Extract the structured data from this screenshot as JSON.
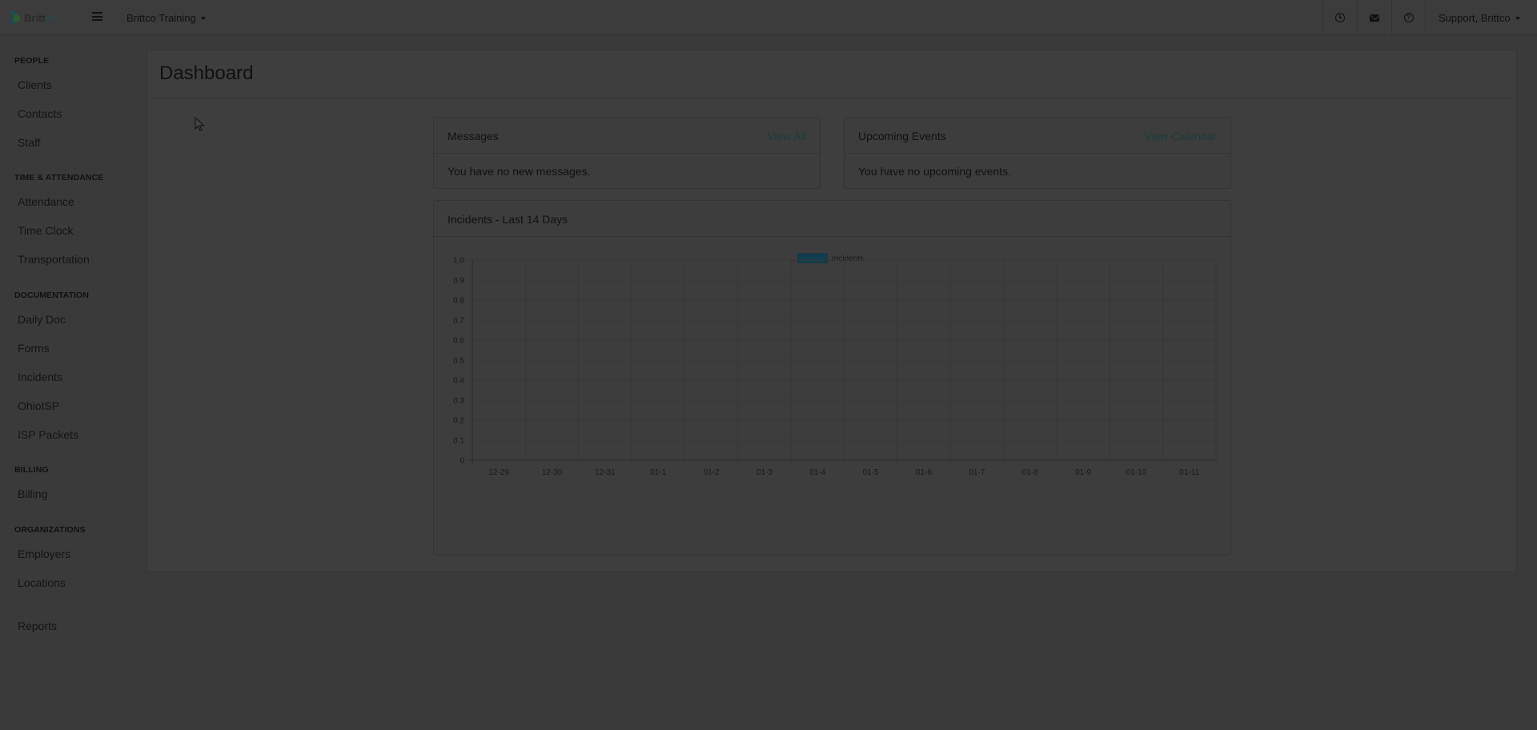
{
  "app": {
    "logo_text": "Britt",
    "logo_text_accent": "co",
    "org_selector": "Brittco Training",
    "user_menu": "Support, Brittco"
  },
  "top_icons": [
    "clock-icon",
    "mail-icon",
    "help-icon"
  ],
  "sidebar": {
    "sections": [
      {
        "heading": "PEOPLE",
        "items": [
          "Clients",
          "Contacts",
          "Staff"
        ]
      },
      {
        "heading": "TIME & ATTENDANCE",
        "items": [
          "Attendance",
          "Time Clock",
          "Transportation"
        ]
      },
      {
        "heading": "DOCUMENTATION",
        "items": [
          "Daily Doc",
          "Forms",
          "Incidents",
          "OhioISP",
          "ISP Packets"
        ]
      },
      {
        "heading": "BILLING",
        "items": [
          "Billing"
        ]
      },
      {
        "heading": "ORGANIZATIONS",
        "items": [
          "Employers",
          "Locations"
        ]
      }
    ],
    "extra_item": "Reports"
  },
  "main": {
    "title": "Dashboard",
    "messages": {
      "title": "Messages",
      "link": "View All",
      "body": "You have no new messages."
    },
    "events": {
      "title": "Upcoming Events",
      "link": "View Calendar",
      "body": "You have no upcoming events."
    },
    "incidents": {
      "title": "Incidents - Last 14 Days"
    }
  },
  "colors": {
    "series": "#123f50",
    "link": "#1b3c3a"
  },
  "chart_data": {
    "type": "bar",
    "categories": [
      "12-29",
      "12-30",
      "12-31",
      "01-1",
      "01-2",
      "01-3",
      "01-4",
      "01-5",
      "01-6",
      "01-7",
      "01-8",
      "01-9",
      "01-10",
      "01-11"
    ],
    "series": [
      {
        "name": "Incidents",
        "values": [
          0,
          0,
          0,
          0,
          0,
          0,
          0,
          0,
          0,
          0,
          0,
          0,
          0,
          0
        ]
      }
    ],
    "y_ticks": [
      "0",
      "0.1",
      "0.2",
      "0.3",
      "0.4",
      "0.5",
      "0.6",
      "0.7",
      "0.8",
      "0.9",
      "1.0"
    ],
    "ylim": [
      0,
      1
    ],
    "legend": "top-center",
    "grid": true
  }
}
